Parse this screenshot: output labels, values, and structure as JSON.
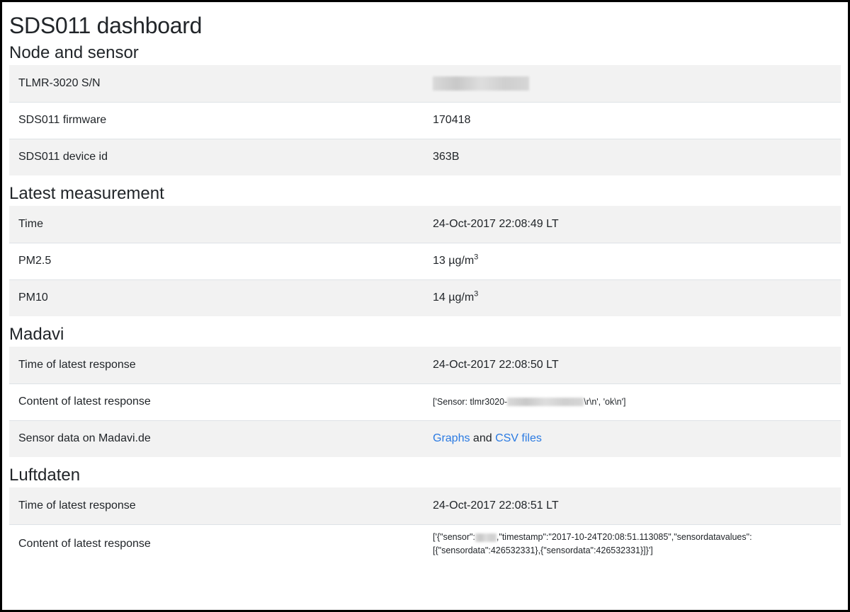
{
  "page_title": "SDS011 dashboard",
  "sections": {
    "node": {
      "heading": "Node and sensor",
      "rows": [
        {
          "label": "TLMR-3020 S/N",
          "value": ""
        },
        {
          "label": "SDS011 firmware",
          "value": "170418"
        },
        {
          "label": "SDS011 device id",
          "value": "363B"
        }
      ]
    },
    "measurement": {
      "heading": "Latest measurement",
      "time_label": "Time",
      "time_value": "24-Oct-2017 22:08:49 LT",
      "pm25_label": "PM2.5",
      "pm25_value": "13",
      "pm10_label": "PM10",
      "pm10_value": "14",
      "unit": "µg/m",
      "unit_exp": "3"
    },
    "madavi": {
      "heading": "Madavi",
      "time_label": "Time of latest response",
      "time_value": "24-Oct-2017 22:08:50 LT",
      "content_label": "Content of latest response",
      "content_prefix": "['Sensor: tlmr3020-",
      "content_suffix": "\\r\\n', 'ok\\n']",
      "data_label": "Sensor data on Madavi.de",
      "link_graphs": "Graphs",
      "link_and": "and",
      "link_csv": "CSV files"
    },
    "luftdaten": {
      "heading": "Luftdaten",
      "time_label": "Time of latest response",
      "time_value": "24-Oct-2017 22:08:51 LT",
      "content_label": "Content of latest response",
      "content_part1": "['{\"sensor\":",
      "content_part2": ",\"timestamp\":\"2017-10-24T20:08:51.113085\",\"sensordatavalues\":",
      "content_line2": "[{\"sensordata\":426532331},{\"sensordata\":426532331}]}']"
    }
  }
}
